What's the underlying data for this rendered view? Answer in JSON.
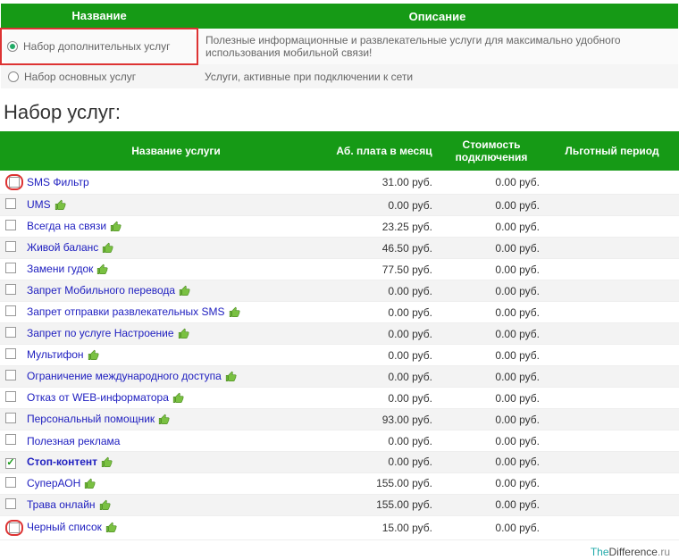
{
  "top_header": {
    "name": "Название",
    "desc": "Описание"
  },
  "sets": [
    {
      "label": "Набор дополнительных услуг",
      "desc": "Полезные информационные и развлекательные услуги для максимально удобного использования мобильной связи!",
      "checked": true,
      "highlight": true
    },
    {
      "label": "Набор основных услуг",
      "desc": "Услуги, активные при подключении к сети",
      "checked": false,
      "highlight": false
    }
  ],
  "section_title": "Набор услуг:",
  "services_header": {
    "name": "Название услуги",
    "fee": "Аб. плата в месяц",
    "cost": "Стоимость подключения",
    "grace": "Льготный период"
  },
  "services": [
    {
      "name": "SMS Фильтр",
      "fee": "31.00 руб.",
      "cost": "0.00 руб.",
      "thumb": false,
      "checked": false,
      "bold": false,
      "highlight": true
    },
    {
      "name": "UMS",
      "fee": "0.00 руб.",
      "cost": "0.00 руб.",
      "thumb": true,
      "checked": false,
      "bold": false,
      "highlight": false
    },
    {
      "name": "Всегда на связи",
      "fee": "23.25 руб.",
      "cost": "0.00 руб.",
      "thumb": true,
      "checked": false,
      "bold": false,
      "highlight": false
    },
    {
      "name": "Живой баланс",
      "fee": "46.50 руб.",
      "cost": "0.00 руб.",
      "thumb": true,
      "checked": false,
      "bold": false,
      "highlight": false
    },
    {
      "name": "Замени гудок",
      "fee": "77.50 руб.",
      "cost": "0.00 руб.",
      "thumb": true,
      "checked": false,
      "bold": false,
      "highlight": false
    },
    {
      "name": "Запрет Мобильного перевода",
      "fee": "0.00 руб.",
      "cost": "0.00 руб.",
      "thumb": true,
      "checked": false,
      "bold": false,
      "highlight": false
    },
    {
      "name": "Запрет отправки развлекательных SMS",
      "fee": "0.00 руб.",
      "cost": "0.00 руб.",
      "thumb": true,
      "checked": false,
      "bold": false,
      "highlight": false
    },
    {
      "name": "Запрет по услуге Настроение",
      "fee": "0.00 руб.",
      "cost": "0.00 руб.",
      "thumb": true,
      "checked": false,
      "bold": false,
      "highlight": false
    },
    {
      "name": "Мультифон",
      "fee": "0.00 руб.",
      "cost": "0.00 руб.",
      "thumb": true,
      "checked": false,
      "bold": false,
      "highlight": false
    },
    {
      "name": "Ограничение международного доступа",
      "fee": "0.00 руб.",
      "cost": "0.00 руб.",
      "thumb": true,
      "checked": false,
      "bold": false,
      "highlight": false
    },
    {
      "name": "Отказ от WEB-информатора",
      "fee": "0.00 руб.",
      "cost": "0.00 руб.",
      "thumb": true,
      "checked": false,
      "bold": false,
      "highlight": false
    },
    {
      "name": "Персональный помощник",
      "fee": "93.00 руб.",
      "cost": "0.00 руб.",
      "thumb": true,
      "checked": false,
      "bold": false,
      "highlight": false
    },
    {
      "name": "Полезная реклама",
      "fee": "0.00 руб.",
      "cost": "0.00 руб.",
      "thumb": false,
      "checked": false,
      "bold": false,
      "highlight": false
    },
    {
      "name": "Стоп-контент",
      "fee": "0.00 руб.",
      "cost": "0.00 руб.",
      "thumb": true,
      "checked": true,
      "bold": true,
      "highlight": false
    },
    {
      "name": "СуперАОН",
      "fee": "155.00 руб.",
      "cost": "0.00 руб.",
      "thumb": true,
      "checked": false,
      "bold": false,
      "highlight": false
    },
    {
      "name": "Трава онлайн",
      "fee": "155.00 руб.",
      "cost": "0.00 руб.",
      "thumb": true,
      "checked": false,
      "bold": false,
      "highlight": false
    },
    {
      "name": "Черный список",
      "fee": "15.00 руб.",
      "cost": "0.00 руб.",
      "thumb": true,
      "checked": false,
      "bold": false,
      "highlight": true
    }
  ],
  "footer": {
    "t1": "The",
    "t2": "Difference",
    "t3": ".ru"
  }
}
